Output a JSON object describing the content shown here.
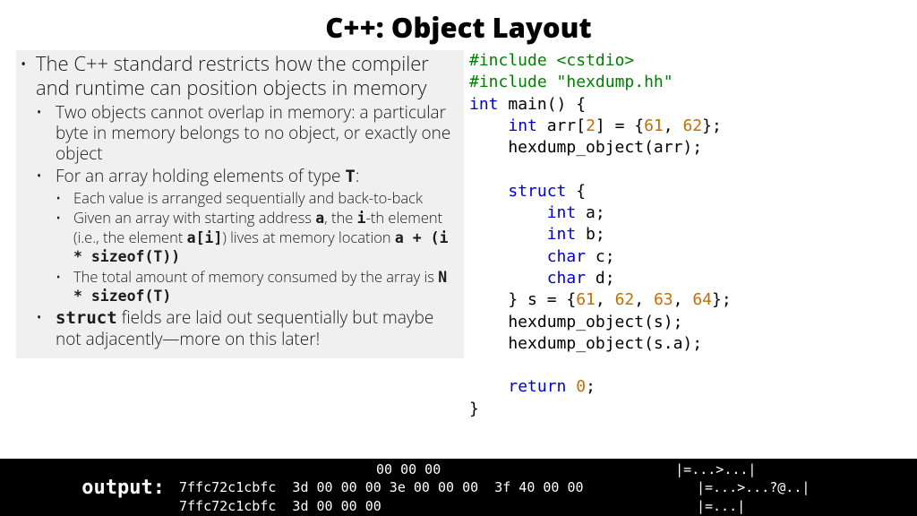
{
  "title": "C++: Object Layout",
  "bullets": {
    "b1": "The C++ standard restricts how the compiler and runtime can position objects in memory",
    "b1_1": "Two objects cannot overlap in memory: a particular byte in memory belongs to no object, or exactly one object",
    "b1_2_pre": "For an array holding elements of type ",
    "b1_2_code": "T",
    "b1_2_post": ":",
    "b1_2_1": "Each value is arranged sequentially and back-to-back",
    "b1_2_2_a": "Given an array with starting address ",
    "b1_2_2_b": "a",
    "b1_2_2_c": ", the ",
    "b1_2_2_d": "i",
    "b1_2_2_e": "-th element (i.e., the element ",
    "b1_2_2_f": "a[i]",
    "b1_2_2_g": ") lives at memory location ",
    "b1_2_2_h": "a + (i * sizeof(T))",
    "b1_2_3_a": "The total amount of memory consumed by the array is ",
    "b1_2_3_b": "N * sizeof(T)",
    "b1_3_a": "struct",
    "b1_3_b": " fields are laid out sequentially but maybe not adjacently—more on this later!"
  },
  "code": {
    "l1a": "#include ",
    "l1b": "<cstdio>",
    "l2a": "#include ",
    "l2b": "\"hexdump.hh\"",
    "l3a": "int",
    "l3b": " main() {",
    "l4a": "    ",
    "l4b": "int",
    "l4c": " arr[",
    "l4d": "2",
    "l4e": "] = {",
    "l4f": "61",
    "l4g": ", ",
    "l4h": "62",
    "l4i": "};",
    "l5": "    hexdump_object(arr);",
    "l6": "",
    "l7a": "    ",
    "l7b": "struct",
    "l7c": " {",
    "l8a": "        ",
    "l8b": "int",
    "l8c": " a;",
    "l9a": "        ",
    "l9b": "int",
    "l9c": " b;",
    "l10a": "        ",
    "l10b": "char",
    "l10c": " c;",
    "l11a": "        ",
    "l11b": "char",
    "l11c": " d;",
    "l12a": "    } s = {",
    "l12b": "61",
    "l12c": ", ",
    "l12d": "62",
    "l12e": ", ",
    "l12f": "63",
    "l12g": ", ",
    "l12h": "64",
    "l12i": "};",
    "l13": "    hexdump_object(s);",
    "l14": "    hexdump_object(s.a);",
    "l15": "",
    "l16a": "    ",
    "l16b": "return",
    "l16c": " ",
    "l16d": "0",
    "l16e": ";",
    "l17": "}"
  },
  "terminal": {
    "label": "output:",
    "line0": "00 00 00                             |=...>...|",
    "line1": "7ffc72c1cbfc  3d 00 00 00 3e 00 00 00  3f 40 00 00              |=...>...?@..|",
    "line2": "7ffc72c1cbfc  3d 00 00 00                                       |=...|"
  }
}
